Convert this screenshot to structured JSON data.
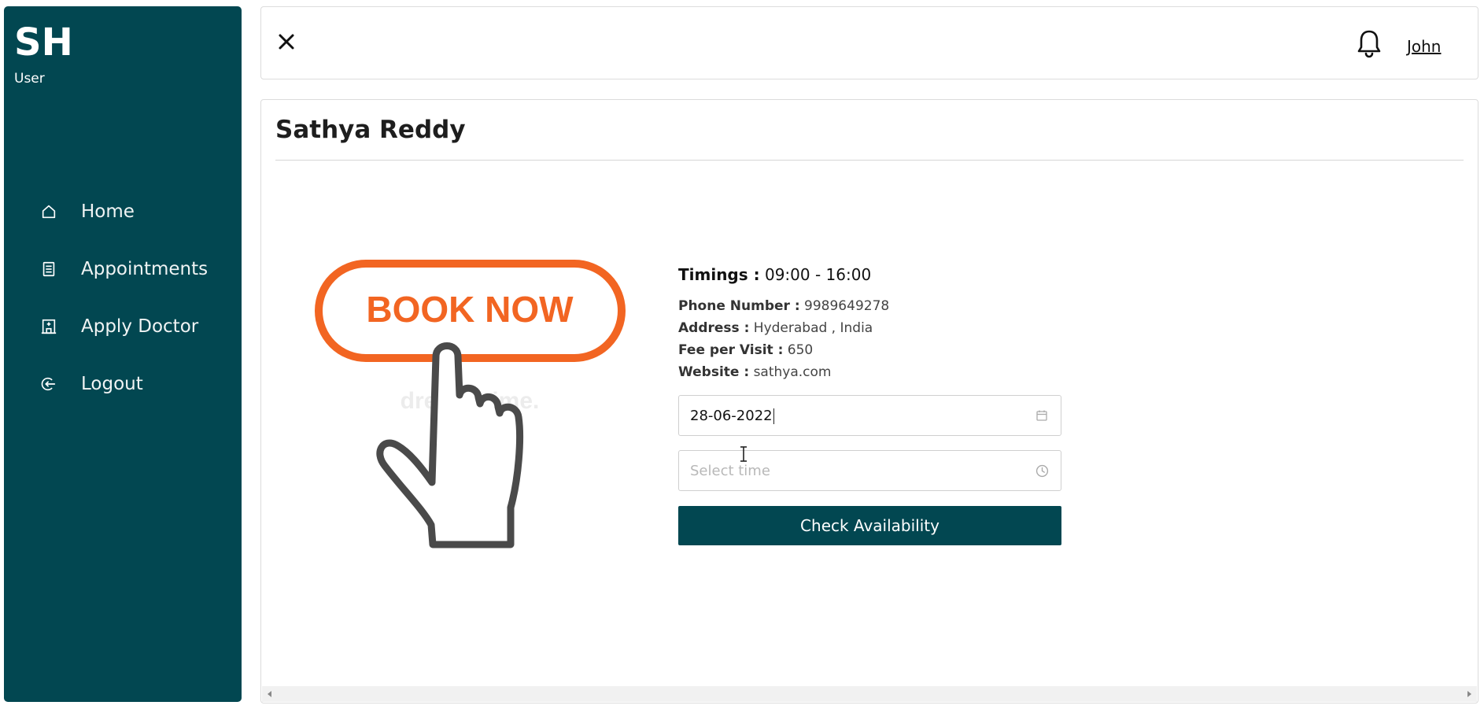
{
  "brand": {
    "initials": "SH",
    "role": "User"
  },
  "sidebar": {
    "items": [
      {
        "label": "Home",
        "icon": "home-icon"
      },
      {
        "label": "Appointments",
        "icon": "clipboard-icon"
      },
      {
        "label": "Apply Doctor",
        "icon": "hospital-icon"
      },
      {
        "label": "Logout",
        "icon": "logout-icon"
      }
    ]
  },
  "header": {
    "close_icon": "close-icon",
    "bell_icon": "bell-icon",
    "user_name": "John"
  },
  "doctor": {
    "name": "Sathya Reddy",
    "timings_label": "Timings :",
    "timings_value": "09:00 - 16:00",
    "phone_label": "Phone Number :",
    "phone_value": "9989649278",
    "address_label": "Address :",
    "address_value": "Hyderabad , India",
    "fee_label": "Fee per Visit :",
    "fee_value": "650",
    "website_label": "Website :",
    "website_value": "sathya.com"
  },
  "booking": {
    "date_value": "28-06-2022",
    "time_placeholder": "Select time",
    "check_label": "Check Availability"
  },
  "promo": {
    "text": "BOOK NOW",
    "watermark": "dreamstime."
  },
  "colors": {
    "primary": "#024751",
    "accent": "#f26522"
  }
}
